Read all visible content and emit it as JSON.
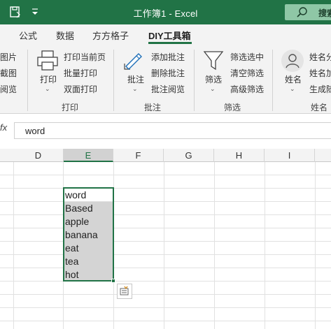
{
  "titlebar": {
    "title": "工作簿1  -  Excel",
    "search_label": "搜索",
    "colors": {
      "bar": "#217346",
      "search_bg": "#8fc7a6"
    }
  },
  "tabs": [
    {
      "label": "公式",
      "active": false
    },
    {
      "label": "数据",
      "active": false
    },
    {
      "label": "方方格子",
      "active": false
    },
    {
      "label": "DIY工具箱",
      "active": true
    }
  ],
  "ribbon": {
    "partial_left": [
      "图片",
      "截图",
      "阅览"
    ],
    "print_group": {
      "big_button": "打印",
      "items": [
        "打印当前页",
        "批量打印",
        "双面打印"
      ],
      "label": "打印"
    },
    "comment_group": {
      "big_button": "批注",
      "items": [
        "添加批注",
        "删除批注",
        "批注阅览"
      ],
      "label": "批注"
    },
    "filter_group": {
      "big_button": "筛选",
      "items": [
        "筛选选中",
        "清空筛选",
        "高级筛选"
      ],
      "label": "筛选"
    },
    "name_group": {
      "big_button": "姓名",
      "items": [
        "姓名分",
        "姓名加",
        "生成随"
      ],
      "label": "姓名"
    }
  },
  "formula_bar": {
    "fx": "fx",
    "content": "word"
  },
  "grid": {
    "columns": [
      "D",
      "E",
      "F",
      "G",
      "H",
      "I"
    ],
    "selected_column": "E",
    "cells": [
      "word",
      "Based",
      "apple",
      "banana",
      "eat",
      "tea",
      "hot"
    ],
    "accent": "#217346"
  }
}
